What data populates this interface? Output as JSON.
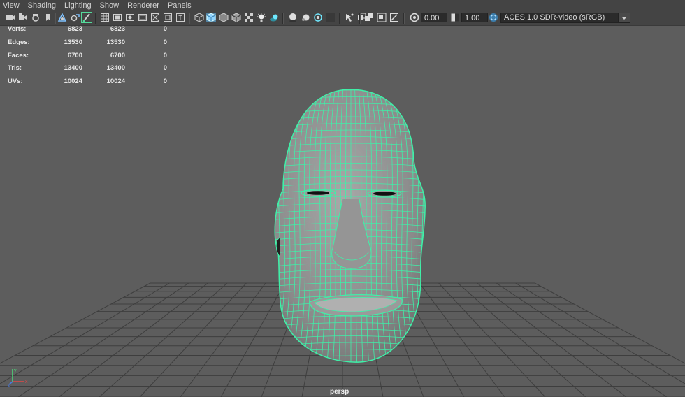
{
  "menu": [
    "View",
    "Shading",
    "Lighting",
    "Show",
    "Renderer",
    "Panels"
  ],
  "toolbar": {
    "exposure_value": "0.00",
    "gamma_value": "1.00",
    "color_space": "ACES 1.0 SDR-video (sRGB)"
  },
  "hud": {
    "rows": [
      {
        "label": "Verts:",
        "a": "6823",
        "b": "6823",
        "c": "0"
      },
      {
        "label": "Edges:",
        "a": "13530",
        "b": "13530",
        "c": "0"
      },
      {
        "label": "Faces:",
        "a": "6700",
        "b": "6700",
        "c": "0"
      },
      {
        "label": "Tris:",
        "a": "13400",
        "b": "13400",
        "c": "0"
      },
      {
        "label": "UVs:",
        "a": "10024",
        "b": "10024",
        "c": "0"
      }
    ]
  },
  "viewport": {
    "camera": "persp",
    "wireframe_color": "#3ff0a8",
    "background_color": "#5d5d5d"
  },
  "axis": {
    "x": "x",
    "y": "y",
    "z": "z"
  }
}
